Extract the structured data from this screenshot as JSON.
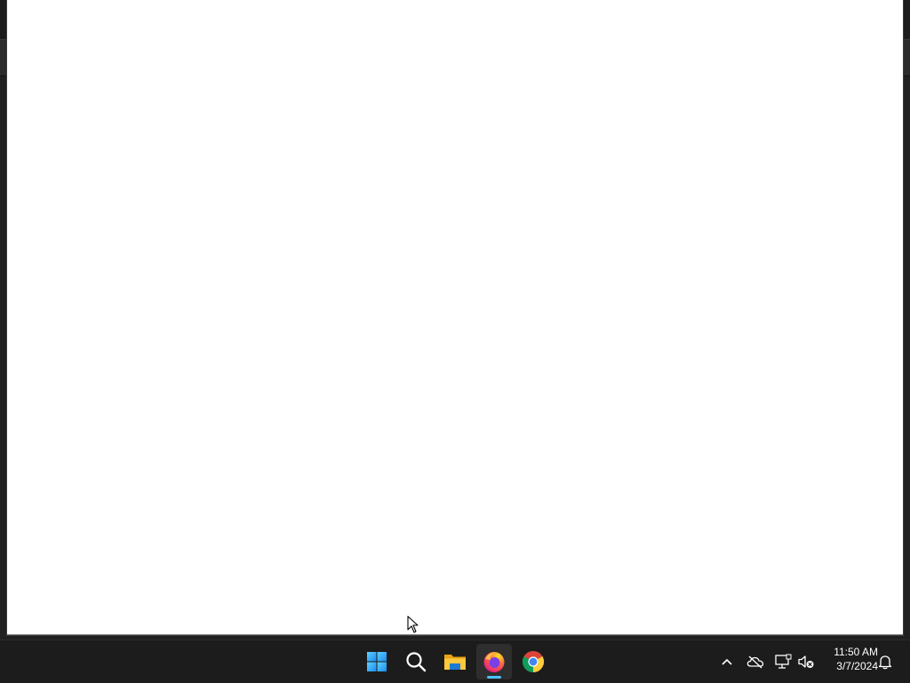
{
  "window": {
    "content": ""
  },
  "taskbar": {
    "apps": [
      {
        "name": "start",
        "icon": "windows-logo-icon"
      },
      {
        "name": "search",
        "icon": "search-icon"
      },
      {
        "name": "file-explorer",
        "icon": "folder-icon"
      },
      {
        "name": "firefox",
        "icon": "firefox-icon",
        "active": true
      },
      {
        "name": "chrome",
        "icon": "chrome-icon"
      }
    ],
    "tray": {
      "icons": [
        "chevron-up-icon",
        "onedrive-offline-icon",
        "network-icon",
        "volume-muted-icon",
        "notification-bell-icon"
      ]
    },
    "clock": {
      "time": "11:50 AM",
      "date": "3/7/2024"
    }
  },
  "colors": {
    "taskbar_bg": "#1c1c1c",
    "accent": "#4cc2ff",
    "window_bg": "#ffffff"
  }
}
